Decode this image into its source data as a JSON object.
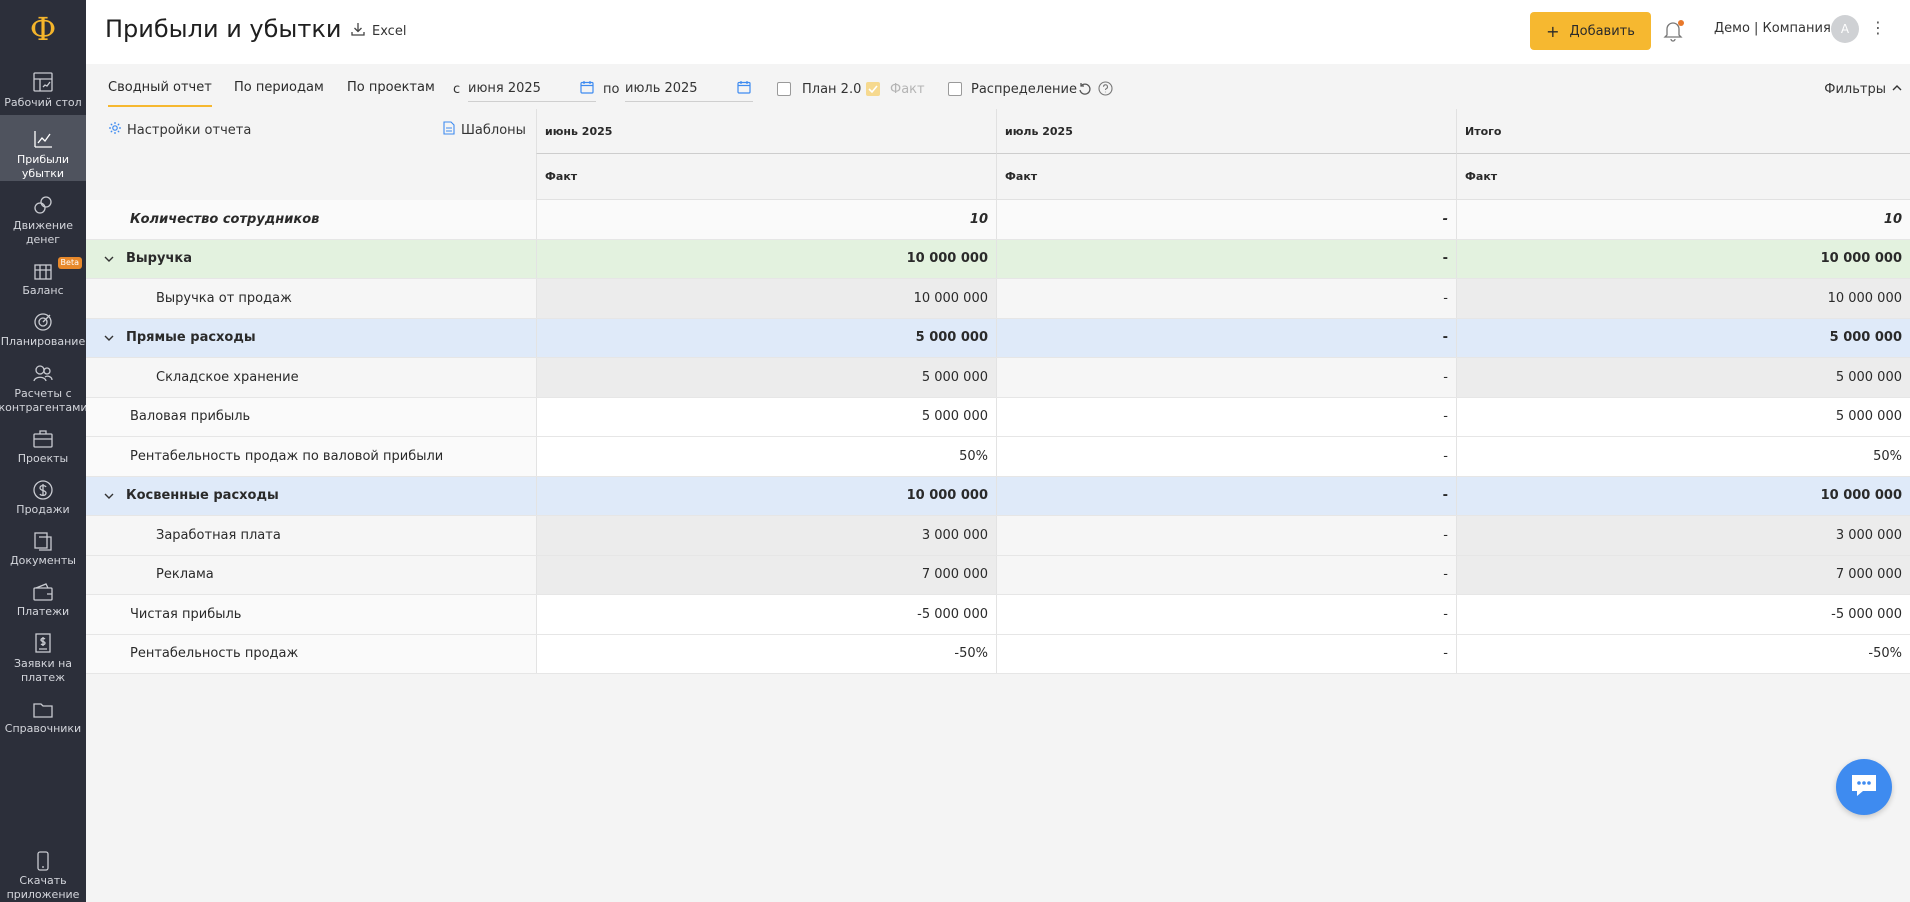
{
  "brand": {
    "logo_glyph": "Ф",
    "accent": "#f6b830"
  },
  "sidebar": {
    "items": [
      {
        "label": "Рабочий стол",
        "icon": "desktop-icon"
      },
      {
        "label": "Прибыли убытки",
        "icon": "chart-icon",
        "active": true
      },
      {
        "label": "Движение денег",
        "icon": "money-flow-icon"
      },
      {
        "label": "Баланс",
        "icon": "balance-icon",
        "badge": "Beta"
      },
      {
        "label": "Планирование",
        "icon": "target-icon"
      },
      {
        "label": "Расчеты с контрагентами",
        "icon": "counterparties-icon"
      },
      {
        "label": "Проекты",
        "icon": "briefcase-icon"
      },
      {
        "label": "Продажи",
        "icon": "dollar-icon"
      },
      {
        "label": "Документы",
        "icon": "documents-icon"
      },
      {
        "label": "Платежи",
        "icon": "wallet-icon"
      },
      {
        "label": "Заявки на платеж",
        "icon": "payment-request-icon"
      },
      {
        "label": "Справочники",
        "icon": "folder-icon"
      }
    ],
    "download_app": "Скачать приложение"
  },
  "header": {
    "title": "Прибыли и убытки",
    "excel_label": "Excel",
    "add_label": "Добавить",
    "company": "Демо | Компания",
    "avatar_initial": "А"
  },
  "toolbar": {
    "tabs": [
      "Сводный отчет",
      "По периодам",
      "По проектам"
    ],
    "from_label": "с",
    "from_value": "июня 2025",
    "to_label": "по",
    "to_value": "июль 2025",
    "plan_label": "План 2.0",
    "fact_label": "Факт",
    "distribution_label": "Распределение",
    "filters_label": "Фильтры"
  },
  "report": {
    "settings_label": "Настройки отчета",
    "templates_label": "Шаблоны",
    "columns": [
      {
        "period": "июнь 2025",
        "kind": "Факт"
      },
      {
        "period": "июль 2025",
        "kind": "Факт"
      },
      {
        "period": "Итого",
        "kind": "Факт"
      }
    ],
    "rows": [
      {
        "name": "Количество сотрудников",
        "values": [
          "10",
          "-",
          "10"
        ],
        "style": "italic"
      },
      {
        "name": "Выручка",
        "values": [
          "10 000 000",
          "-",
          "10 000 000"
        ],
        "style": "group-green"
      },
      {
        "name": "Выручка от продаж",
        "values": [
          "10 000 000",
          "-",
          "10 000 000"
        ],
        "style": "sub"
      },
      {
        "name": "Прямые расходы",
        "values": [
          "5 000 000",
          "-",
          "5 000 000"
        ],
        "style": "group-blue"
      },
      {
        "name": "Складское хранение",
        "values": [
          "5 000 000",
          "-",
          "5 000 000"
        ],
        "style": "sub"
      },
      {
        "name": "Валовая прибыль",
        "values": [
          "5 000 000",
          "-",
          "5 000 000"
        ],
        "style": "plain"
      },
      {
        "name": "Рентабельность продаж по валовой прибыли",
        "values": [
          "50%",
          "-",
          "50%"
        ],
        "style": "plain"
      },
      {
        "name": "Косвенные расходы",
        "values": [
          "10 000 000",
          "-",
          "10 000 000"
        ],
        "style": "group-blue"
      },
      {
        "name": "Заработная плата",
        "values": [
          "3 000 000",
          "-",
          "3 000 000"
        ],
        "style": "sub"
      },
      {
        "name": "Реклама",
        "values": [
          "7 000 000",
          "-",
          "7 000 000"
        ],
        "style": "sub"
      },
      {
        "name": "Чистая прибыль",
        "values": [
          "-5 000 000",
          "-",
          "-5 000 000"
        ],
        "style": "plain"
      },
      {
        "name": "Рентабельность продаж",
        "values": [
          "-50%",
          "-",
          "-50%"
        ],
        "style": "plain"
      }
    ]
  }
}
